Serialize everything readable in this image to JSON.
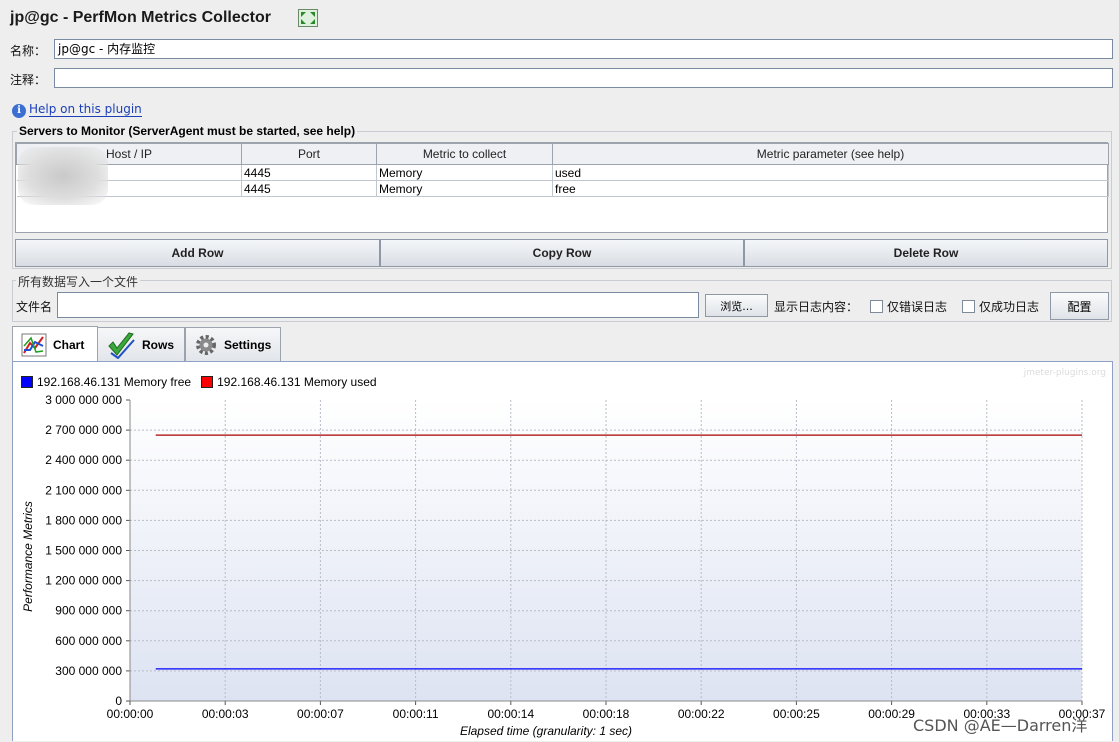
{
  "window": {
    "title": "jp@gc - PerfMon Metrics Collector"
  },
  "form": {
    "name_label": "名称：",
    "name_value": "jp@gc - 内存监控",
    "comment_label": "注释：",
    "comment_value": ""
  },
  "help": {
    "link_text": "Help on this plugin"
  },
  "servers": {
    "title": "Servers to Monitor (ServerAgent must be started, see help)",
    "columns": [
      "Host / IP",
      "Port",
      "Metric to collect",
      "Metric parameter (see help)"
    ],
    "rows": [
      {
        "host": "",
        "port": "4445",
        "metric": "Memory",
        "param": "used"
      },
      {
        "host": "",
        "port": "4445",
        "metric": "Memory",
        "param": "free"
      }
    ],
    "buttons": {
      "add": "Add Row",
      "copy": "Copy Row",
      "delete": "Delete Row"
    }
  },
  "file": {
    "group_title": "所有数据写入一个文件",
    "label": "文件名",
    "value": "",
    "browse": "浏览...",
    "log_label": "显示日志内容：",
    "errors_only": "仅错误日志",
    "success_only": "仅成功日志",
    "config": "配置"
  },
  "tabs": [
    {
      "label": "Chart",
      "icon": "chart-icon"
    },
    {
      "label": "Rows",
      "icon": "checkmark-icon"
    },
    {
      "label": "Settings",
      "icon": "gear-icon"
    }
  ],
  "chart": {
    "watermark": "jmeter-plugins.org",
    "legend": [
      {
        "label": "192.168.46.131 Memory free",
        "color": "#0000ff"
      },
      {
        "label": "192.168.46.131 Memory used",
        "color": "#ff0000"
      }
    ],
    "xlabel": "Elapsed time (granularity: 1 sec)",
    "ylabel": "Performance Metrics",
    "yticks": [
      "3 000 000 000",
      "2 700 000 000",
      "2 400 000 000",
      "2 100 000 000",
      "1 800 000 000",
      "1 500 000 000",
      "1 200 000 000",
      "900 000 000",
      "600 000 000",
      "300 000 000",
      "0"
    ],
    "xticks": [
      "00:00:00",
      "00:00:03",
      "00:00:07",
      "00:00:11",
      "00:00:14",
      "00:00:18",
      "00:00:22",
      "00:00:25",
      "00:00:29",
      "00:00:33",
      "00:00:37"
    ]
  },
  "chart_data": {
    "type": "line",
    "title": "",
    "xlabel": "Elapsed time (granularity: 1 sec)",
    "ylabel": "Performance Metrics",
    "ylim": [
      0,
      3000000000
    ],
    "xlim": [
      "00:00:00",
      "00:00:37"
    ],
    "grid": true,
    "legend_position": "top-left",
    "series": [
      {
        "name": "192.168.46.131 Memory free",
        "color": "#0000ff",
        "x": [
          "00:00:01",
          "00:00:37"
        ],
        "values": [
          320000000,
          320000000
        ]
      },
      {
        "name": "192.168.46.131 Memory used",
        "color": "#aa0000",
        "x": [
          "00:00:01",
          "00:00:37"
        ],
        "values": [
          2650000000,
          2650000000
        ]
      }
    ]
  },
  "overlay": {
    "csdn": "CSDN @AE—Darren洋"
  }
}
